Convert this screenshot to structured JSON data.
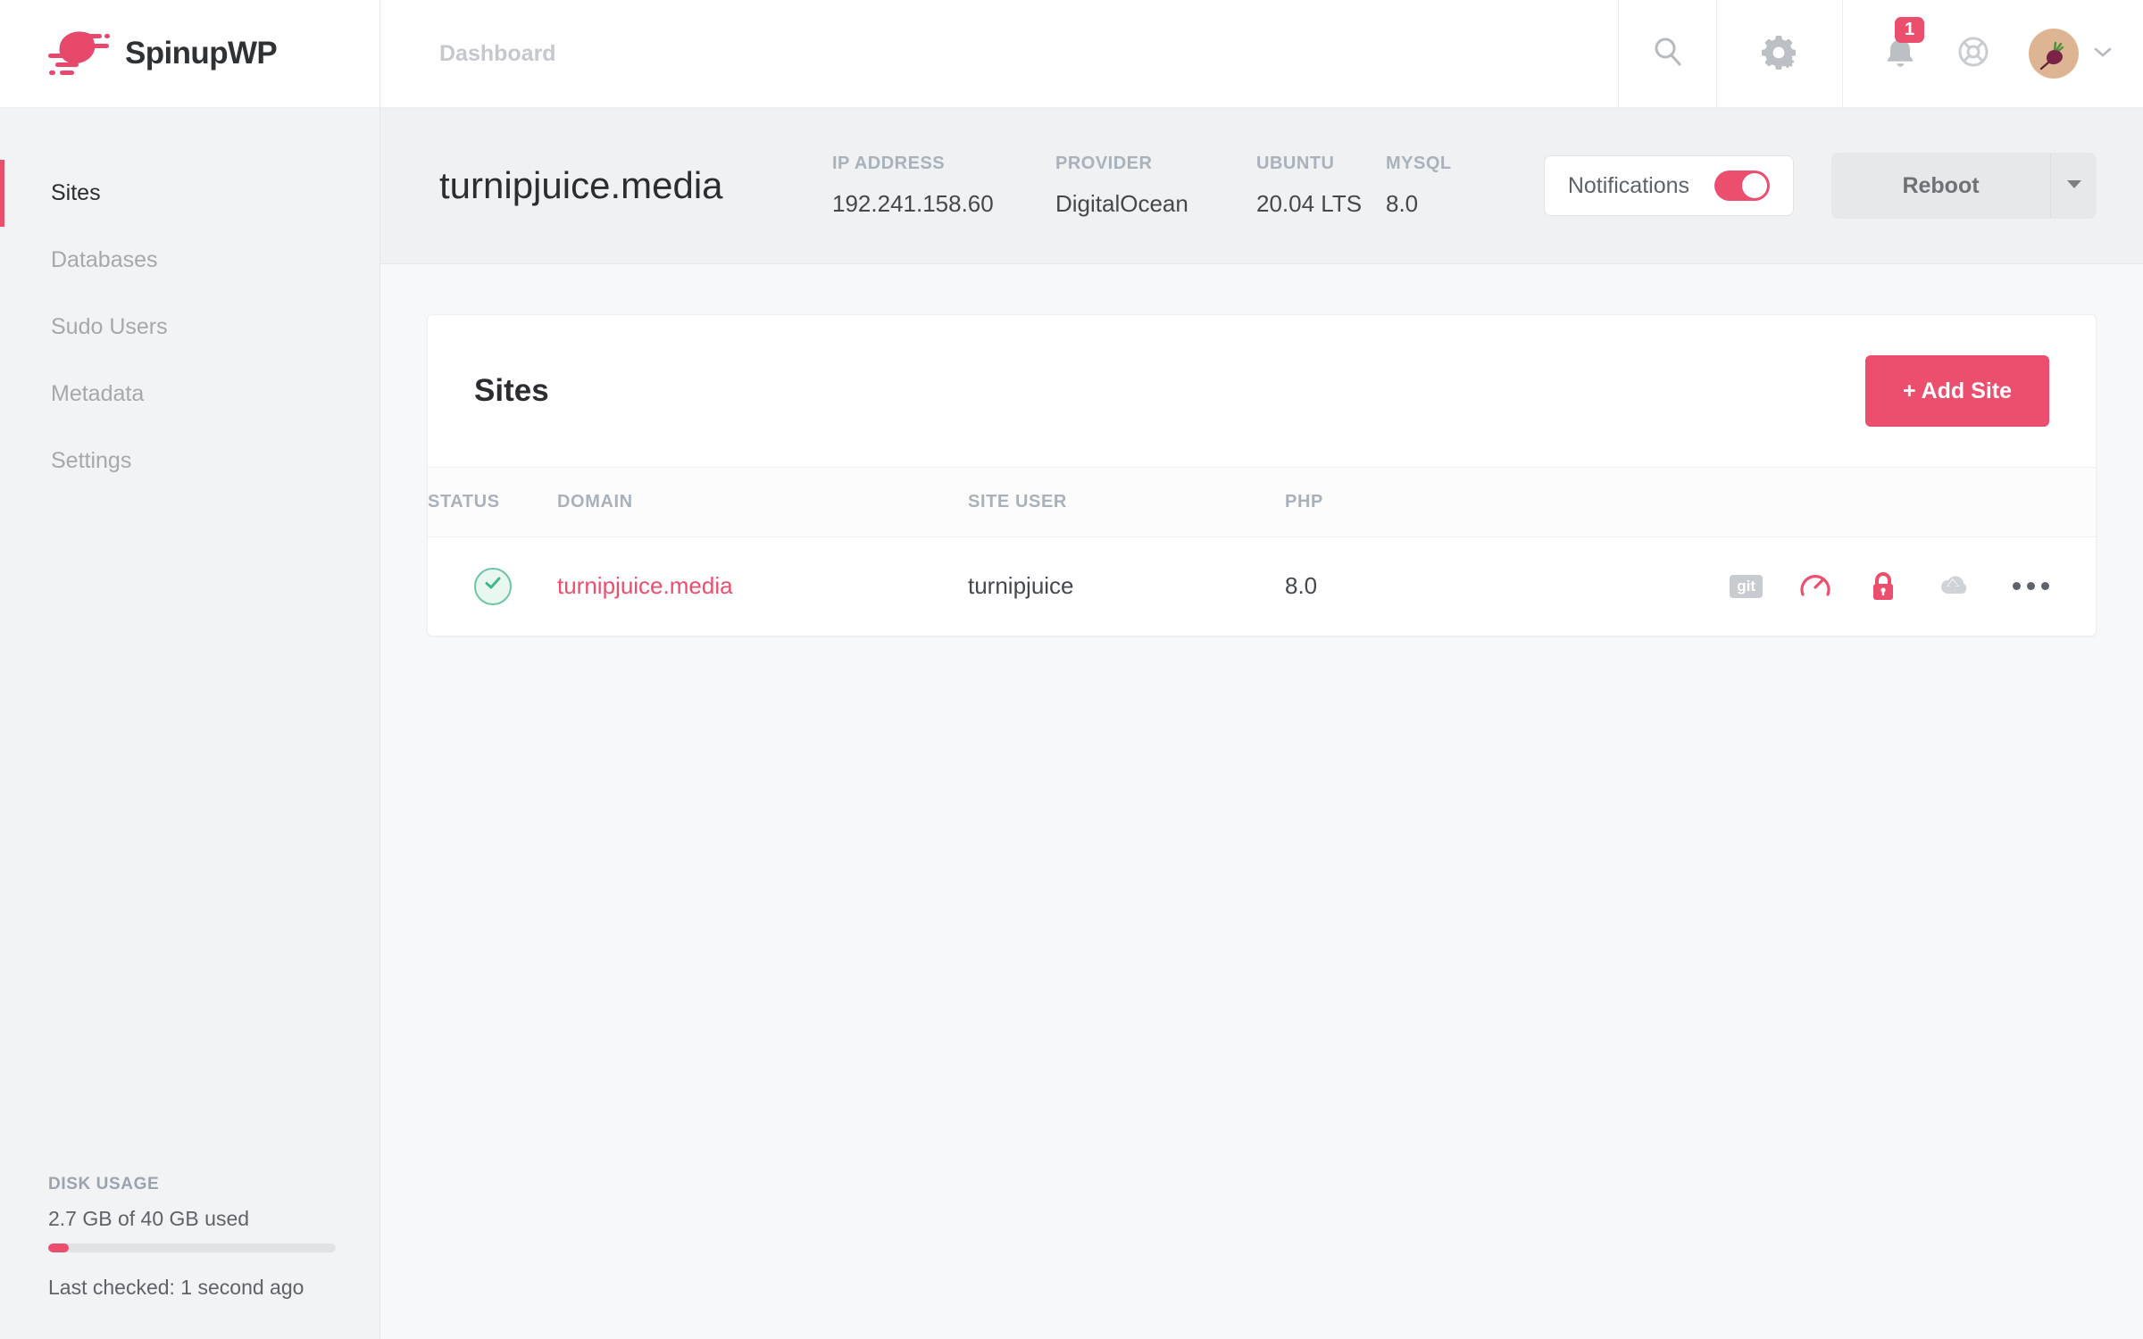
{
  "brand": {
    "name": "SpinupWP",
    "accent": "#ec4e6e",
    "logo_icon": "spinupwp-swoosh-logo"
  },
  "topbar": {
    "breadcrumb": "Dashboard",
    "search_icon": "search-icon",
    "settings_icon": "gears-icon",
    "notifications_icon": "bell-icon",
    "notifications_count": "1",
    "support_icon": "life-ring-icon",
    "avatar_emoji": "🥬",
    "avatar_label": "beet-avatar",
    "chevron_icon": "chevron-down-icon"
  },
  "server": {
    "name": "turnipjuice.media",
    "meta": [
      {
        "label": "IP ADDRESS",
        "value": "192.241.158.60"
      },
      {
        "label": "PROVIDER",
        "value": "DigitalOcean"
      },
      {
        "label": "UBUNTU",
        "value": "20.04 LTS"
      },
      {
        "label": "MYSQL",
        "value": "8.0"
      }
    ],
    "notifications_label": "Notifications",
    "notifications_on": true,
    "reboot_label": "Reboot",
    "reboot_caret_icon": "caret-down-icon"
  },
  "sidebar": {
    "items": [
      {
        "label": "Sites",
        "active": true
      },
      {
        "label": "Databases",
        "active": false
      },
      {
        "label": "Sudo Users",
        "active": false
      },
      {
        "label": "Metadata",
        "active": false
      },
      {
        "label": "Settings",
        "active": false
      }
    ],
    "disk": {
      "title": "DISK USAGE",
      "usage_text": "2.7 GB of 40 GB used",
      "percent": 7,
      "last_checked": "Last checked: 1 second ago"
    }
  },
  "sites_card": {
    "title": "Sites",
    "add_button": "+ Add Site",
    "columns": [
      "STATUS",
      "DOMAIN",
      "SITE USER",
      "PHP"
    ],
    "rows": [
      {
        "status": "ok",
        "domain": "turnipjuice.media",
        "site_user": "turnipjuice",
        "php": "8.0",
        "actions": [
          "git-icon",
          "gauge-icon",
          "lock-icon",
          "cloud-upload-icon",
          "more-options-icon"
        ]
      }
    ]
  }
}
